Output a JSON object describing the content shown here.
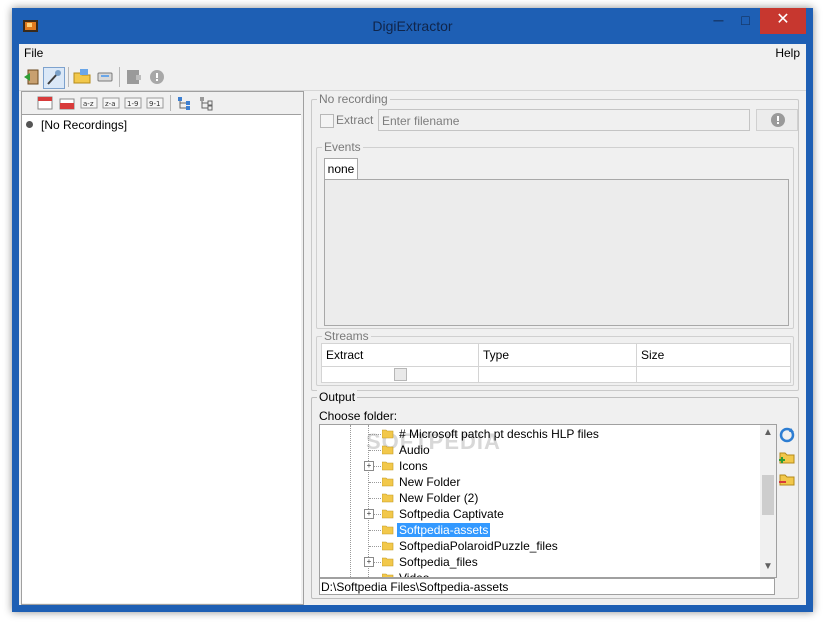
{
  "window": {
    "title": "DigiExtractor"
  },
  "titlebar": {
    "minimize": "─",
    "maximize": "□",
    "close": "✕"
  },
  "menu": {
    "file": "File",
    "help": "Help"
  },
  "toolbar": {
    "icons": [
      "exit-icon",
      "settings-icon",
      "open-folder-icon",
      "disk-icon",
      "record-icon",
      "info-icon"
    ]
  },
  "left_pane": {
    "tools": [
      "calendar-icon",
      "calendar-red-icon",
      "sort-az-icon",
      "sort-za-icon",
      "sort-19-icon",
      "sort-91-icon",
      "expand-tree-icon",
      "collapse-tree-icon"
    ],
    "recordings": [
      "[No Recordings]"
    ]
  },
  "recording": {
    "legend": "No recording",
    "extract_label": "Extract",
    "filename_placeholder": "Enter filename",
    "events": {
      "legend": "Events",
      "tab": "none"
    },
    "streams": {
      "legend": "Streams",
      "columns": [
        "Extract",
        "Type",
        "Size"
      ]
    }
  },
  "output": {
    "legend": "Output",
    "choose_label": "Choose folder:",
    "watermark": "SOFTPEDIA",
    "tree": [
      {
        "label": "# Microsoft patch pt deschis HLP files",
        "expandable": false,
        "selected": false
      },
      {
        "label": "Audio",
        "expandable": false,
        "selected": false
      },
      {
        "label": "Icons",
        "expandable": true,
        "selected": false
      },
      {
        "label": "New Folder",
        "expandable": false,
        "selected": false
      },
      {
        "label": "New Folder (2)",
        "expandable": false,
        "selected": false
      },
      {
        "label": "Softpedia Captivate",
        "expandable": true,
        "selected": false
      },
      {
        "label": "Softpedia-assets",
        "expandable": false,
        "selected": true
      },
      {
        "label": "SoftpediaPolaroidPuzzle_files",
        "expandable": false,
        "selected": false
      },
      {
        "label": "Softpedia_files",
        "expandable": true,
        "selected": false
      },
      {
        "label": "Video",
        "expandable": false,
        "selected": false
      }
    ],
    "path": "D:\\Softpedia Files\\Softpedia-assets",
    "side_buttons": [
      "refresh-icon",
      "new-folder-icon",
      "delete-folder-icon"
    ]
  },
  "colors": {
    "frame": "#1e5fb4",
    "close": "#c7372f",
    "selection": "#3399ff",
    "panel": "#f0f0f0"
  }
}
